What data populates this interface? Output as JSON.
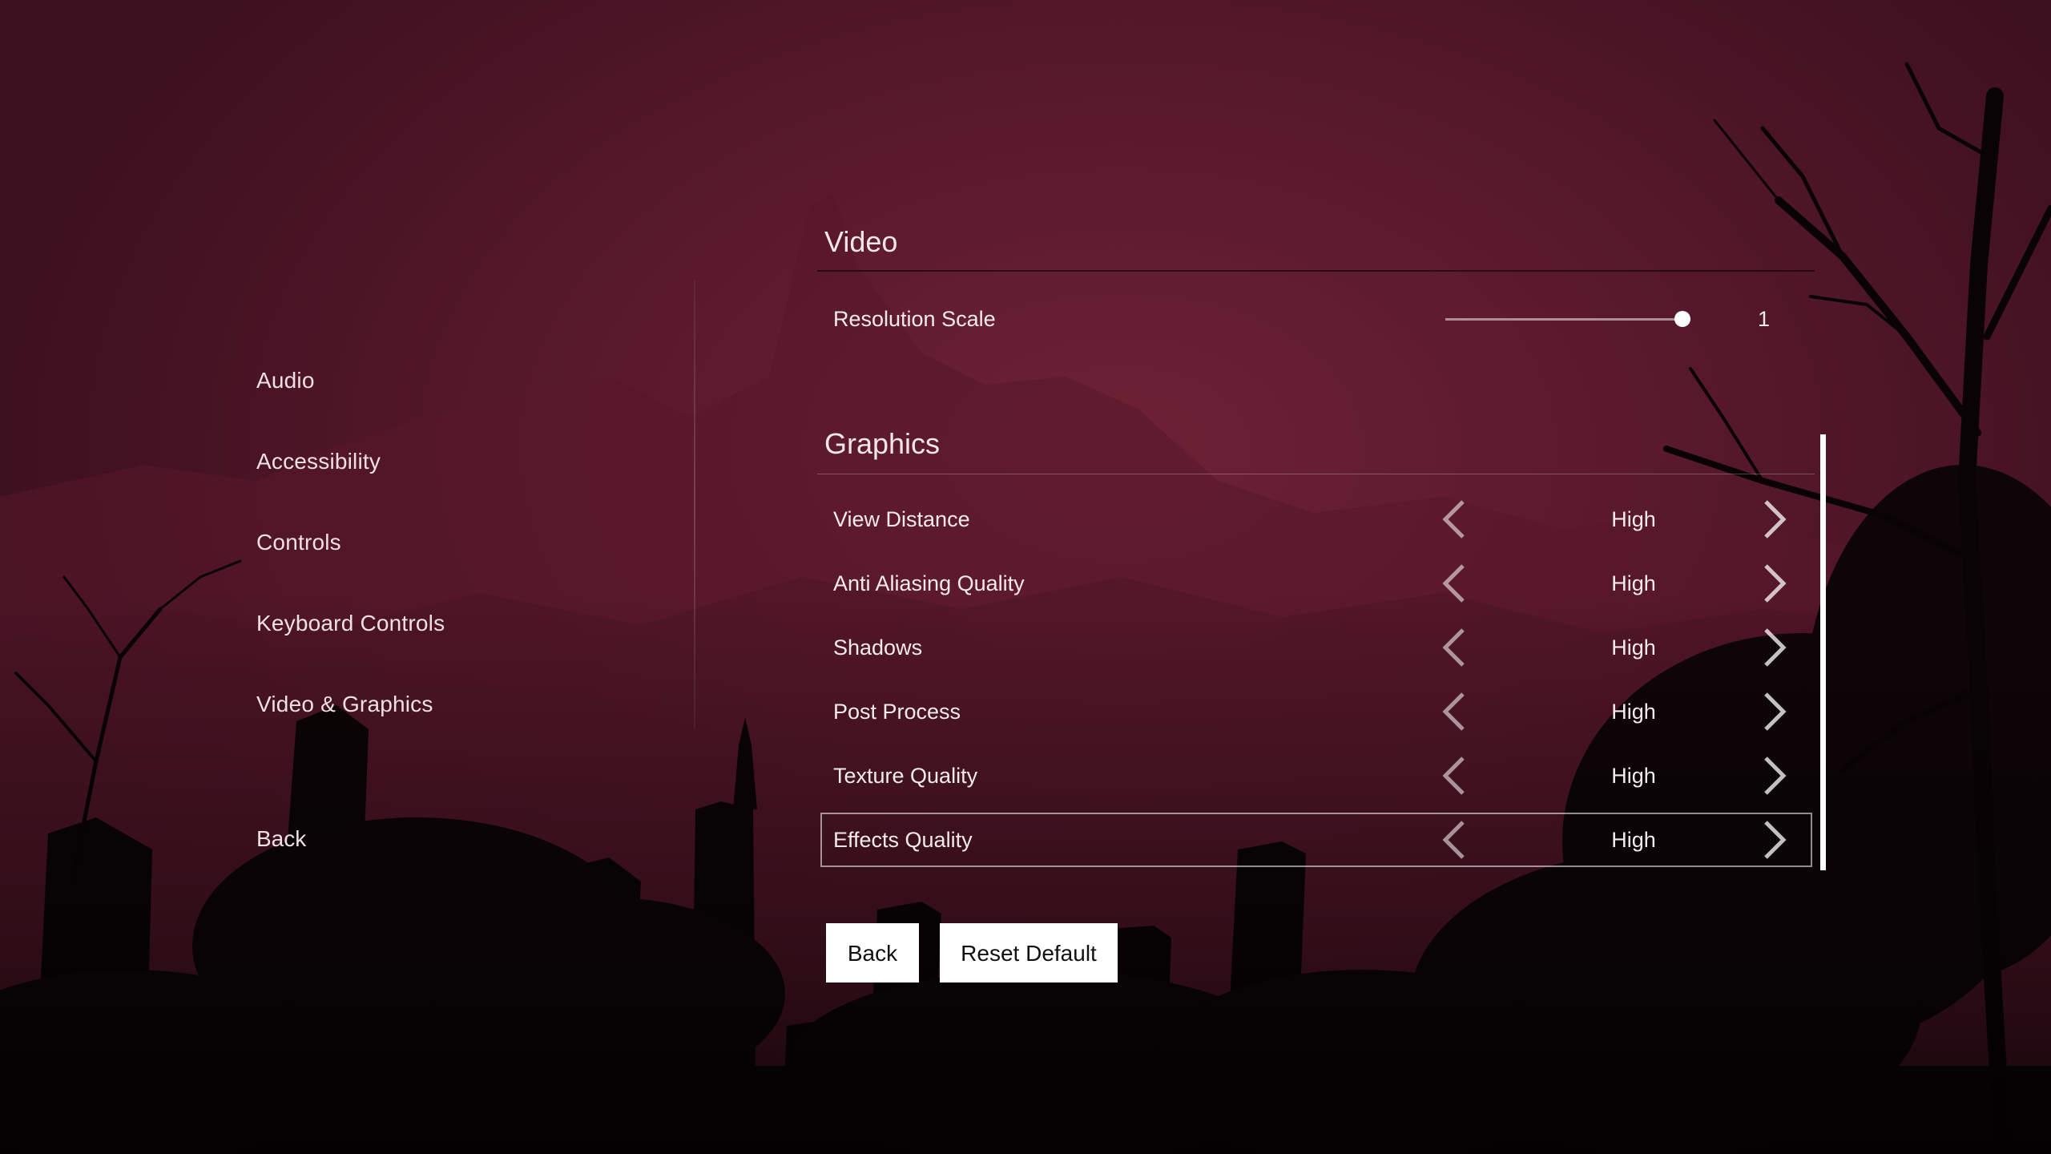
{
  "side_menu": {
    "items": [
      {
        "label": "Audio"
      },
      {
        "label": "Accessibility"
      },
      {
        "label": "Controls"
      },
      {
        "label": "Keyboard Controls"
      },
      {
        "label": "Video & Graphics"
      }
    ],
    "back_label": "Back"
  },
  "video": {
    "title": "Video",
    "resolution_scale": {
      "label": "Resolution Scale",
      "value": "1",
      "fraction": 0.97
    }
  },
  "graphics": {
    "title": "Graphics",
    "rows": [
      {
        "label": "View Distance",
        "value": "High"
      },
      {
        "label": "Anti Aliasing Quality",
        "value": "High"
      },
      {
        "label": "Shadows",
        "value": "High"
      },
      {
        "label": "Post Process",
        "value": "High"
      },
      {
        "label": "Texture Quality",
        "value": "High"
      },
      {
        "label": "Effects Quality",
        "value": "High",
        "selected": true
      }
    ]
  },
  "buttons": {
    "back_label": "Back",
    "reset_label": "Reset Default"
  },
  "icons": {
    "left": "chevron-left-icon",
    "right": "chevron-right-icon"
  },
  "colors": {
    "background": "#5a1a2c",
    "text": "#f3eaec",
    "button_bg": "#ffffff",
    "button_text": "#111111"
  }
}
